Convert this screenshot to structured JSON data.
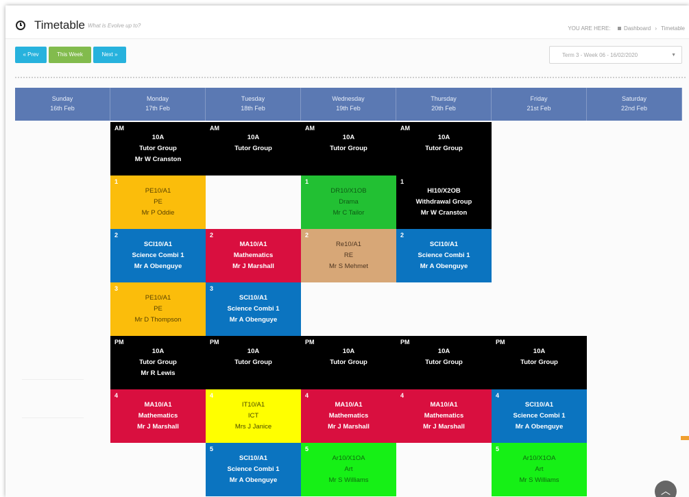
{
  "header": {
    "title": "Timetable",
    "subtitle": "What is Evolve up to?",
    "breadcrumb": {
      "prefix": "YOU ARE HERE:",
      "home": "Dashboard",
      "current": "Timetable"
    }
  },
  "toolbar": {
    "prev_label": "« Prev",
    "this_week_label": "This Week",
    "next_label": "Next »",
    "term_select": "Term 3 - Week 06 - 16/02/2020"
  },
  "days": [
    {
      "name": "Sunday",
      "date": "16th Feb"
    },
    {
      "name": "Monday",
      "date": "17th Feb"
    },
    {
      "name": "Tuesday",
      "date": "18th Feb"
    },
    {
      "name": "Wednesday",
      "date": "19th Feb"
    },
    {
      "name": "Thursday",
      "date": "20th Feb"
    },
    {
      "name": "Friday",
      "date": "21st Feb"
    },
    {
      "name": "Saturday",
      "date": "22nd Feb"
    }
  ],
  "slots": [
    {
      "day": "Monday",
      "row": "AM",
      "period": "AM",
      "lines": [
        "10A",
        "Tutor Group",
        "Mr W Cranston"
      ],
      "color": "#000000"
    },
    {
      "day": "Tuesday",
      "row": "AM",
      "period": "AM",
      "lines": [
        "10A",
        "Tutor Group"
      ],
      "color": "#000000"
    },
    {
      "day": "Wednesday",
      "row": "AM",
      "period": "AM",
      "lines": [
        "10A",
        "Tutor Group"
      ],
      "color": "#000000"
    },
    {
      "day": "Thursday",
      "row": "AM",
      "period": "AM",
      "lines": [
        "10A",
        "Tutor Group"
      ],
      "color": "#000000"
    },
    {
      "day": "Monday",
      "row": "P1",
      "period": "1",
      "lines": [
        "PE10/A1",
        "PE",
        "Mr P Oddie"
      ],
      "color": "#fbbd0b",
      "text": "#5a4200"
    },
    {
      "day": "Wednesday",
      "row": "P1",
      "period": "1",
      "lines": [
        "DR10/X1OB",
        "Drama",
        "Mr C Tailor"
      ],
      "color": "#22c033",
      "text": "#0d5a14"
    },
    {
      "day": "Thursday",
      "row": "P1",
      "period": "1",
      "lines": [
        "HI10/X2OB",
        "Withdrawal Group",
        "Mr W Cranston"
      ],
      "color": "#000000"
    },
    {
      "day": "Monday",
      "row": "P2",
      "period": "2",
      "lines": [
        "SCI10/A1",
        "Science Combi 1",
        "Mr A Obenguye"
      ],
      "color": "#0b74c0"
    },
    {
      "day": "Tuesday",
      "row": "P2",
      "period": "2",
      "lines": [
        "MA10/A1",
        "Mathematics",
        "Mr J Marshall"
      ],
      "color": "#d90f3f"
    },
    {
      "day": "Wednesday",
      "row": "P2",
      "period": "2",
      "lines": [
        "Re10/A1",
        "RE",
        "Mr S Mehmet"
      ],
      "color": "#d7a777",
      "text": "#4d3520"
    },
    {
      "day": "Thursday",
      "row": "P2",
      "period": "2",
      "lines": [
        "SCI10/A1",
        "Science Combi 1",
        "Mr A Obenguye"
      ],
      "color": "#0b74c0"
    },
    {
      "day": "Monday",
      "row": "P3",
      "period": "3",
      "lines": [
        "PE10/A1",
        "PE",
        "Mr D Thompson"
      ],
      "color": "#fbbd0b",
      "text": "#5a4200"
    },
    {
      "day": "Tuesday",
      "row": "P3",
      "period": "3",
      "lines": [
        "SCI10/A1",
        "Science Combi 1",
        "Mr A Obenguye"
      ],
      "color": "#0b74c0"
    },
    {
      "day": "Monday",
      "row": "PM",
      "period": "PM",
      "lines": [
        "10A",
        "Tutor Group",
        "Mr R Lewis"
      ],
      "color": "#000000"
    },
    {
      "day": "Tuesday",
      "row": "PM",
      "period": "PM",
      "lines": [
        "10A",
        "Tutor Group"
      ],
      "color": "#000000"
    },
    {
      "day": "Wednesday",
      "row": "PM",
      "period": "PM",
      "lines": [
        "10A",
        "Tutor Group"
      ],
      "color": "#000000"
    },
    {
      "day": "Thursday",
      "row": "PM",
      "period": "PM",
      "lines": [
        "10A",
        "Tutor Group"
      ],
      "color": "#000000"
    },
    {
      "day": "Friday",
      "row": "PM",
      "period": "PM",
      "lines": [
        "10A",
        "Tutor Group"
      ],
      "color": "#000000"
    },
    {
      "day": "Monday",
      "row": "P4",
      "period": "4",
      "lines": [
        "MA10/A1",
        "Mathematics",
        "Mr J Marshall"
      ],
      "color": "#d90f3f"
    },
    {
      "day": "Tuesday",
      "row": "P4",
      "period": "4",
      "lines": [
        "IT10/A1",
        "ICT",
        "Mrs J Janice"
      ],
      "color": "#ffff00",
      "text": "#4a4a00"
    },
    {
      "day": "Wednesday",
      "row": "P4",
      "period": "4",
      "lines": [
        "MA10/A1",
        "Mathematics",
        "Mr J Marshall"
      ],
      "color": "#d90f3f"
    },
    {
      "day": "Thursday",
      "row": "P4",
      "period": "4",
      "lines": [
        "MA10/A1",
        "Mathematics",
        "Mr J Marshall"
      ],
      "color": "#d90f3f"
    },
    {
      "day": "Friday",
      "row": "P4",
      "period": "4",
      "lines": [
        "SCI10/A1",
        "Science Combi 1",
        "Mr A Obenguye"
      ],
      "color": "#0b74c0"
    },
    {
      "day": "Tuesday",
      "row": "P5",
      "period": "5",
      "lines": [
        "SCI10/A1",
        "Science Combi 1",
        "Mr A Obenguye"
      ],
      "color": "#0b74c0"
    },
    {
      "day": "Wednesday",
      "row": "P5",
      "period": "5",
      "lines": [
        "Ar10/X1OA",
        "Art",
        "Mr S Williams"
      ],
      "color": "#16f016",
      "text": "#0d6a0d"
    },
    {
      "day": "Friday",
      "row": "P5",
      "period": "5",
      "lines": [
        "Ar10/X1OA",
        "Art",
        "Mr S Williams"
      ],
      "color": "#16f016",
      "text": "#0d6a0d"
    }
  ],
  "scroll_top_icon": "chevron-up-icon",
  "colors": {
    "header_bar": "#5b79b3",
    "btn_blue": "#27b2dd",
    "btn_green": "#82bb4d"
  }
}
